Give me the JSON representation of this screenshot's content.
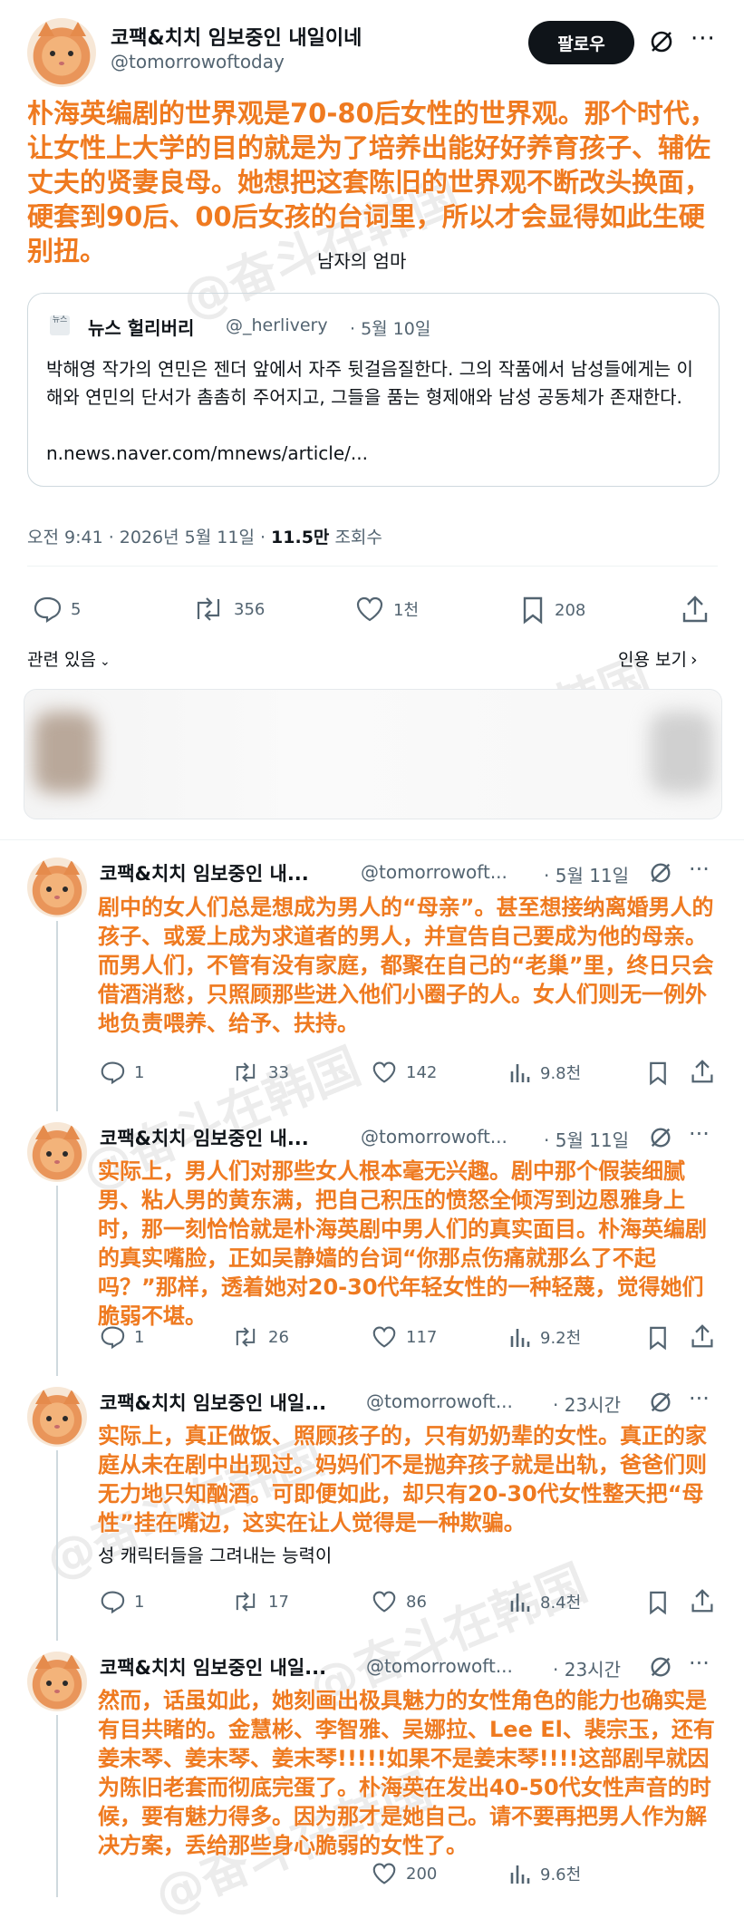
{
  "main": {
    "author_name": "코팩&치치 임보중인 내일이네",
    "author_handle": "@tomorrowoftoday",
    "follow_label": "팔로우",
    "overlay_text": "朴海英编剧的世界观是70-80后女性的世界观。那个时代，让女性上大学的目的就是为了培养出能好好养育孩子、辅佐丈夫的贤妻良母。她想把这套陈旧的世界观不断改头换面，硬套到90后、00后女孩的台词里，所以才会显得如此生硬别扭。",
    "korean_tail": "남자의 엄마",
    "quote": {
      "logo_text": "뉴스 헐리버리",
      "name": "뉴스 헐리버리",
      "handle": "@_herlivery",
      "date": "· 5월 10일",
      "text": "박해영 작가의 연민은 젠더 앞에서 자주 뒷걸음질한다. 그의 작품에서 남성들에게는 이해와 연민의 단서가 촘촘히 주어지고, 그들을 품는 형제애와 남성 공동체가 존재한다.",
      "link": "n.news.naver.com/mnews/article/..."
    },
    "timestamp": "오전 9:41 · 2026년 5월 11일 · ",
    "views_count": "11.5만",
    "views_label": " 조회수",
    "replies": "5",
    "retweets": "356",
    "likes": "1천",
    "bookmarks": "208",
    "related_label": "관련 있음",
    "quotes_label": "인용 보기"
  },
  "replies": [
    {
      "name": "코팩&치치 임보중인 내...",
      "handle": "@tomorrowoft...",
      "time": "· 5월 11일",
      "text": "剧中的女人们总是想成为男人的“母亲”。甚至想接纳离婚男人的孩子、或爱上成为求道者的男人，并宣告自己要成为他的母亲。而男人们，不管有没有家庭，都聚在自己的“老巢”里，终日只会借酒消愁，只照顾那些进入他们小圈子的人。女人们则无一例外地负责喂养、给予、扶持。",
      "replies": "1",
      "retweets": "33",
      "likes": "142",
      "views": "9.8천"
    },
    {
      "name": "코팩&치치 임보중인 내...",
      "handle": "@tomorrowoft...",
      "time": "· 5월 11일",
      "text": "实际上，男人们对那些女人根本毫无兴趣。剧中那个假装细腻男、粘人男的黄东满，把自己积压的愤怒全倾泻到边恩雅身上时，那一刻恰恰就是朴海英剧中男人们的真实面目。朴海英编剧的真实嘴脸，正如吴静嫱的台词“你那点伤痛就那么了不起吗？”那样，透着她对20-30代年轻女性的一种轻蔑，觉得她们脆弱不堪。",
      "replies": "1",
      "retweets": "26",
      "likes": "117",
      "views": "9.2천"
    },
    {
      "name": "코팩&치치 임보중인 내일...",
      "handle": "@tomorrowoft...",
      "time": "· 23시간",
      "text": "实际上，真正做饭、照顾孩子的，只有奶奶辈的女性。真正的家庭从未在剧中出现过。妈妈们不是抛弃孩子就是出轨，爸爸们则无力地只知酗酒。可即便如此，却只有20-30代女性整天把“母性”挂在嘴边，这实在让人觉得是一种欺骗。",
      "korean_tail": "성 캐릭터들을 그려내는 능력이",
      "replies": "1",
      "retweets": "17",
      "likes": "86",
      "views": "8.4천"
    },
    {
      "name": "코팩&치치 임보중인 내일...",
      "handle": "@tomorrowoft...",
      "time": "· 23시간",
      "text": "然而，话虽如此，她刻画出极具魅力的女性角色的能力也确实是有目共睹的。金慧彬、李智雅、吴娜拉、Lee El、裴宗玉，还有姜末琴、姜末琴、姜末琴!!!!!如果不是姜末琴!!!!这部剧早就因为陈旧老套而彻底完蛋了。朴海英在发出40-50代女性声音的时候，要有魅力得多。因为那才是她自己。请不要再把男人作为解决方案，丢给那些身心脆弱的女性了。",
      "replies": "",
      "retweets": "",
      "likes": "200",
      "views": "9.6천"
    }
  ],
  "watermark": "@奋斗在韩国",
  "colors": {
    "overlay": "#ef7a20",
    "muted": "#536471",
    "text": "#0f1419"
  }
}
